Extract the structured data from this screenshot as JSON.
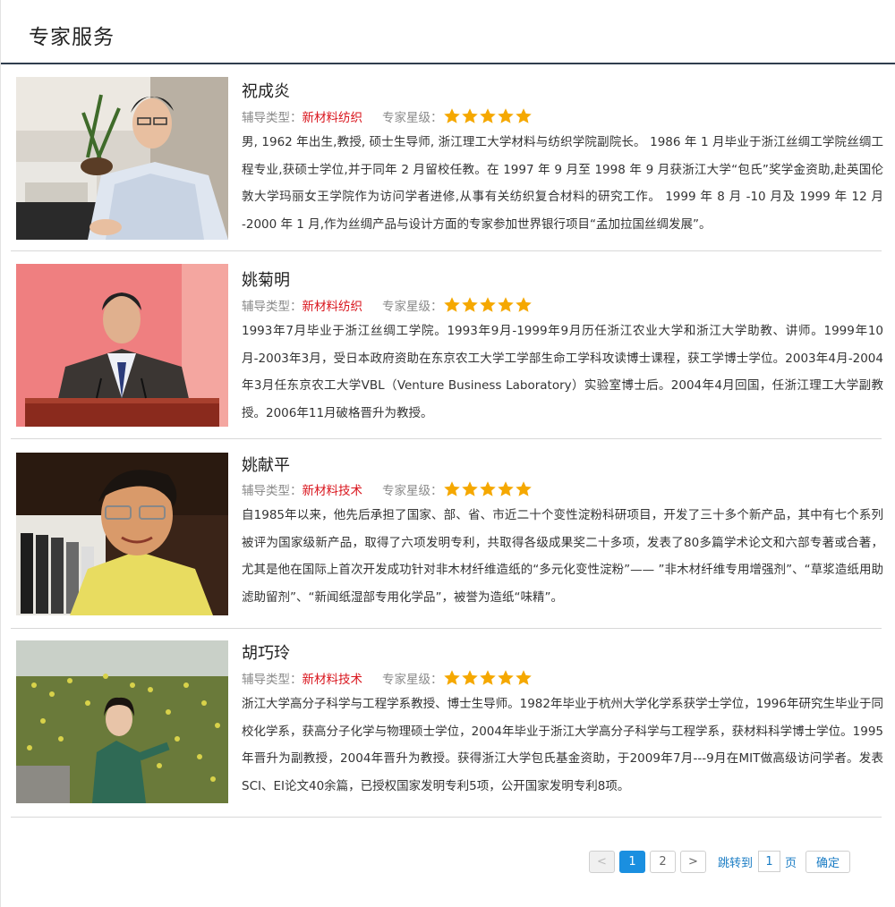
{
  "page": {
    "title": "专家服务"
  },
  "labels": {
    "type_prefix": "辅导类型：",
    "rating_prefix": "专家星级："
  },
  "experts": [
    {
      "name": "祝成炎",
      "type": "新材料纺织",
      "stars": 5,
      "desc": "男, 1962 年出生,教授, 硕士生导师, 浙江理工大学材料与纺织学院副院长。 1986 年 1 月毕业于浙江丝绸工学院丝绸工程专业,获硕士学位,并于同年 2 月留校任教。在 1997 年 9 月至 1998 年 9 月获浙江大学“包氏”奖学金资助,赴英国伦敦大学玛丽女王学院作为访问学者进修,从事有关纺织复合材料的研究工作。 1999 年 8 月 -10 月及 1999 年 12 月 -2000 年 1 月,作为丝绸产品与设计方面的专家参加世界银行项目“孟加拉国丝绸发展”。"
    },
    {
      "name": "姚菊明",
      "type": "新材料纺织",
      "stars": 5,
      "desc": "1993年7月毕业于浙江丝绸工学院。1993年9月-1999年9月历任浙江农业大学和浙江大学助教、讲师。1999年10月-2003年3月，受日本政府资助在东京农工大学工学部生命工学科攻读博士课程，获工学博士学位。2003年4月-2004年3月任东京农工大学VBL（Venture Business Laboratory）实验室博士后。2004年4月回国，任浙江理工大学副教授。2006年11月破格晋升为教授。"
    },
    {
      "name": "姚献平",
      "type": "新材料技术",
      "stars": 5,
      "desc": "自1985年以来，他先后承担了国家、部、省、市近二十个变性淀粉科研项目，开发了三十多个新产品，其中有七个系列被评为国家级新产品，取得了六项发明专利，共取得各级成果奖二十多项，发表了80多篇学术论文和六部专著或合著，尤其是他在国际上首次开发成功针对非木材纤维造纸的“多元化变性淀粉”—— ”非木材纤维专用增强剂”、“草浆造纸用助滤助留剂”、“新闻纸湿部专用化学品”，被誉为造纸“味精”。"
    },
    {
      "name": "胡巧玲",
      "type": "新材料技术",
      "stars": 5,
      "desc": "浙江大学高分子科学与工程学系教授、博士生导师。1982年毕业于杭州大学化学系获学士学位，1996年研究生毕业于同校化学系，获高分子化学与物理硕士学位，2004年毕业于浙江大学高分子科学与工程学系，获材料科学博士学位。1995年晋升为副教授，2004年晋升为教授。获得浙江大学包氏基金资助，于2009年7月---9月在MIT做高级访问学者。发表SCI、EI论文40余篇，已授权国家发明专利5项，公开国家发明专利8项。"
    }
  ],
  "pager": {
    "prev": "<",
    "pages": [
      "1",
      "2"
    ],
    "current": "1",
    "next": ">",
    "jump_label": "跳转到",
    "jump_value": "1",
    "page_unit": "页",
    "confirm": "确定"
  },
  "colors": {
    "accent_red": "#d9141c",
    "star": "#f5a800",
    "pager_blue": "#1a8fe0",
    "header_rule": "#2f3e4e"
  }
}
